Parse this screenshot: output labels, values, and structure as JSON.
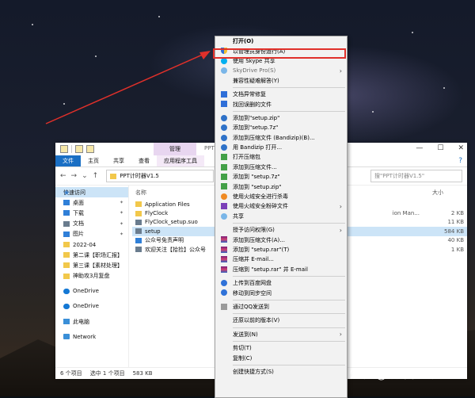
{
  "explorer": {
    "title": "PPT",
    "ribbon_tool_header": "管理",
    "tabs": [
      "文件",
      "主页",
      "共享",
      "查看",
      "应用程序工具"
    ],
    "window_controls": [
      "—",
      "☐",
      "✕"
    ],
    "address": "PPT计时器V1.5",
    "search": "搜\"PPT计时器V1.5\"",
    "help_icon": "?",
    "column_name": "名称",
    "column_size": "大小",
    "sidebar": [
      {
        "label": "快速访问",
        "icon": "star"
      },
      {
        "label": "桌面",
        "icon": "blue"
      },
      {
        "label": "下载",
        "icon": "blue"
      },
      {
        "label": "文档",
        "icon": "gray"
      },
      {
        "label": "图片",
        "icon": "blue"
      },
      {
        "label": "2022-04",
        "icon": "folder"
      },
      {
        "label": "第二课【职场汇报】",
        "icon": "folder"
      },
      {
        "label": "第三课【素材处理】",
        "icon": "folder"
      },
      {
        "label": "神助攻3月复盘",
        "icon": "folder"
      },
      {
        "label": "OneDrive",
        "icon": "cloud"
      },
      {
        "label": "OneDrive",
        "icon": "cloud"
      },
      {
        "label": "此电脑",
        "icon": "pc"
      },
      {
        "label": "Network",
        "icon": "net"
      }
    ],
    "files": [
      {
        "name": "Application Files",
        "type": "",
        "size": ""
      },
      {
        "name": "FlyClock",
        "type": "ion Man...",
        "size": "2 KB"
      },
      {
        "name": "FlyClock_setup.suo",
        "type": "",
        "size": "11 KB"
      },
      {
        "name": "setup",
        "type": "",
        "size": "584 KB"
      },
      {
        "name": "公众号免责声明",
        "type": "",
        "size": "40 KB"
      },
      {
        "name": "欢迎关注【拾捡】公众号",
        "type": "",
        "size": "1 KB"
      }
    ],
    "status": {
      "count": "6 个项目",
      "selected": "选中 1 个项目",
      "size": "583 KB"
    }
  },
  "context_menu": {
    "items": [
      {
        "label": "打开(O)",
        "bold": true
      },
      {
        "label": "以管理员身份运行(A)",
        "icon": "shield",
        "highlight": true
      },
      {
        "label": "使用 Skype 共享",
        "icon": "skype"
      },
      {
        "label": "SkyDrive Pro(S)",
        "icon": "sky",
        "gray": true,
        "submenu": true
      },
      {
        "label": "兼容性疑难解答(Y)"
      },
      {
        "sep": true
      },
      {
        "label": "文档异常修复",
        "icon": "doc"
      },
      {
        "label": "找回误删的文件",
        "icon": "doc"
      },
      {
        "sep": true
      },
      {
        "label": "添加到\"setup.zip\"",
        "icon": "bz"
      },
      {
        "label": "添加到\"setup.7z\"",
        "icon": "bz"
      },
      {
        "label": "添加到压缩文件 (Bandizip)(B)...",
        "icon": "bz"
      },
      {
        "label": "用 Bandizip 打开...",
        "icon": "bz"
      },
      {
        "label": "打开压缩包",
        "icon": "green"
      },
      {
        "label": "添加到压缩文件...",
        "icon": "green"
      },
      {
        "label": "添加到 \"setup.7z\"",
        "icon": "green"
      },
      {
        "label": "添加到 \"setup.zip\"",
        "icon": "green"
      },
      {
        "label": "使用火绒安全进行杀毒",
        "icon": "orange"
      },
      {
        "label": "使用火绒安全粉碎文件",
        "icon": "purple",
        "submenu": true
      },
      {
        "label": "共享",
        "icon": "sky"
      },
      {
        "sep": true
      },
      {
        "label": "授予访问权限(G)",
        "submenu": true
      },
      {
        "label": "添加到压缩文件(A)...",
        "icon": "rar"
      },
      {
        "label": "添加到 \"setup.rar\"(T)",
        "icon": "rar"
      },
      {
        "label": "压缩并 E-mail...",
        "icon": "rar"
      },
      {
        "label": "压缩到 \"setup.rar\" 并 E-mail",
        "icon": "rar"
      },
      {
        "sep": true
      },
      {
        "label": "上传到百度网盘",
        "icon": "baidu"
      },
      {
        "label": "移动到同步空间",
        "icon": "baidu"
      },
      {
        "sep": true
      },
      {
        "label": "通过QQ发送到",
        "icon": "qq"
      },
      {
        "sep": true
      },
      {
        "label": "还原以前的版本(V)"
      },
      {
        "sep": true
      },
      {
        "label": "发送到(N)",
        "submenu": true
      },
      {
        "sep": true
      },
      {
        "label": "剪切(T)"
      },
      {
        "label": "复制(C)"
      },
      {
        "sep": true
      },
      {
        "label": "创建快捷方式(S)"
      }
    ]
  },
  "watermark": "知乎 @银河小卫比",
  "colors": {
    "highlight": "#e0302a",
    "arrow": "#e0302a",
    "file_tab": "#1a6fc4",
    "selection": "#cce4f7"
  }
}
